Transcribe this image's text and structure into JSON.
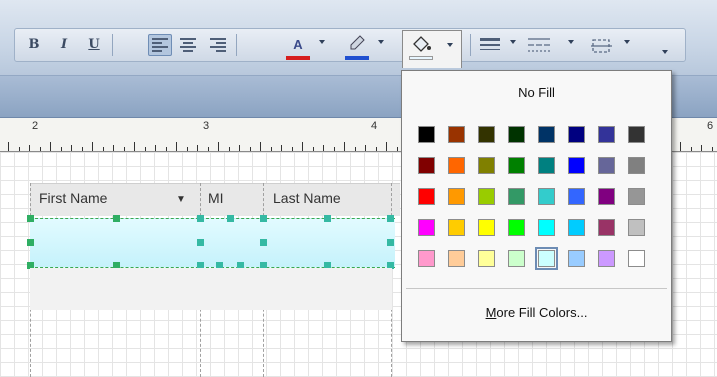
{
  "toolbar": {
    "bold_label": "B",
    "italic_label": "I",
    "underline_label": "U",
    "align_left": "align-left-icon",
    "align_center": "align-center-icon",
    "align_right": "align-right-icon",
    "font_color_glyph": "A",
    "font_color": "#d61e1e",
    "highlight_color": "#2050d0",
    "fill_color_icon": "paint-bucket-icon",
    "fill_color": "#e8f6ff"
  },
  "ruler": {
    "labels": [
      "2",
      "3",
      "4",
      "6"
    ]
  },
  "table": {
    "headers": [
      "First Name",
      "MI",
      "Last Name"
    ],
    "header_dropdown": "▼"
  },
  "fill_menu": {
    "no_fill_label": "No Fill",
    "more_colors_label": "More Fill Colors...",
    "more_colors_accel": "M",
    "more_colors_rest": "ore Fill Colors...",
    "selected_swatch": "#ccffff",
    "colors": [
      [
        "#000000",
        "#993300",
        "#333300",
        "#003300",
        "#003366",
        "#000080",
        "#333399",
        "#333333"
      ],
      [
        "#800000",
        "#ff6600",
        "#808000",
        "#008000",
        "#008080",
        "#0000ff",
        "#666699",
        "#808080"
      ],
      [
        "#ff0000",
        "#ff9900",
        "#99cc00",
        "#339966",
        "#33cccc",
        "#3366ff",
        "#800080",
        "#969696"
      ],
      [
        "#ff00ff",
        "#ffcc00",
        "#ffff00",
        "#00ff00",
        "#00ffff",
        "#00ccff",
        "#993366",
        "#c0c0c0"
      ],
      [
        "#ff99cc",
        "#ffcc99",
        "#ffff99",
        "#ccffcc",
        "#ccffff",
        "#99ccff",
        "#cc99ff",
        "#ffffff"
      ]
    ]
  }
}
